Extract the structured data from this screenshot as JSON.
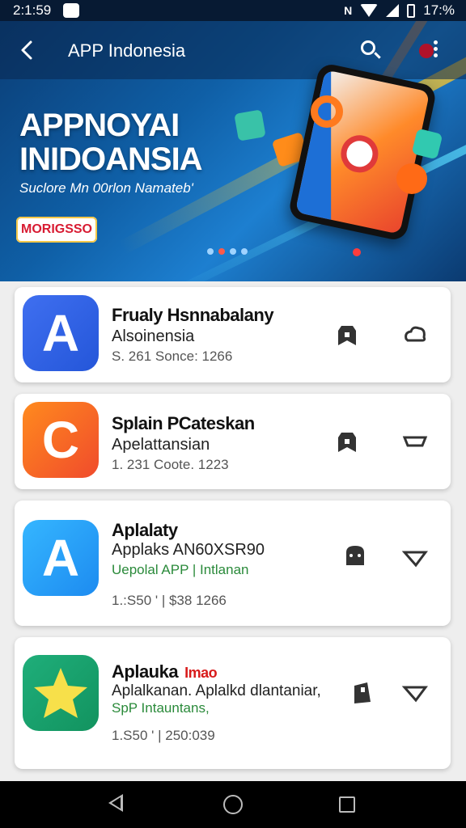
{
  "status_bar": {
    "time": "2:1:59",
    "battery": "17:%"
  },
  "app_bar": {
    "title": "APP Indonesia"
  },
  "banner": {
    "title": "APPNOYAI INIDOANSIA",
    "subtitle": "Suclore Mn 00rlon Namateb'",
    "badge": "MORIGSSO"
  },
  "apps": [
    {
      "name": "Frualy Hsnnabalany",
      "subtitle": "Alsoinensia",
      "extra": "",
      "meta": "S. 261 Sonce: 1266",
      "tag": ""
    },
    {
      "name": "Splain PCateskan",
      "subtitle": "Apelattansian",
      "extra": "",
      "meta": "1. 231 Coote. 1223",
      "tag": ""
    },
    {
      "name": "Aplalaty",
      "subtitle": "Applaks AN60XSR90",
      "extra": "Uepolal APP | Intlanan",
      "meta": "1.:S50 ' | $38 1266",
      "tag": ""
    },
    {
      "name": "Aplauka",
      "subtitle": "Aplalkanan. Aplalkd dlantaniar,",
      "extra": "SpP Intauntans,",
      "meta": "1.S50 ' | 250:039",
      "tag": "Imao"
    }
  ],
  "icons": {
    "card_actions": [
      "lock-icon",
      "cloud-icon"
    ],
    "nav": [
      "back-icon",
      "home-icon",
      "recents-icon"
    ]
  },
  "colors": {
    "accent": "#0f5fa6",
    "green_text": "#2a8a3a",
    "red_tag": "#d81b1b"
  }
}
